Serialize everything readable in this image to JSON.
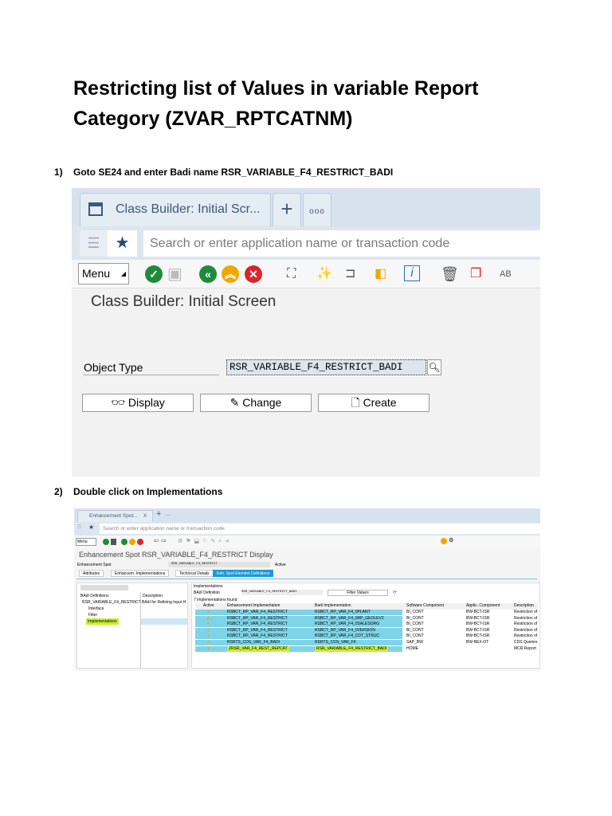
{
  "document": {
    "title_line1": "Restricting list of Values in variable Report",
    "title_line2": "Category (ZVAR_RPTCATNM)",
    "steps": [
      {
        "number": "1)",
        "text": "Goto SE24 and enter Badi name RSR_VARIABLE_F4_RESTRICT_BADI"
      },
      {
        "number": "2)",
        "text": "Double click on Implementations"
      }
    ]
  },
  "screenshot1": {
    "tab_title": "Class Builder: Initial Scr...",
    "add_tab": "+",
    "more_tabs": "ooo",
    "search_placeholder": "Search or enter application name or transaction code",
    "menu_label": "Menu",
    "screen_title": "Class Builder: Initial Screen",
    "object_type_label": "Object Type",
    "object_type_value": "RSR_VARIABLE_F4_RESTRICT_BADI",
    "buttons": {
      "display": "Display",
      "change": "Change",
      "create": "Create"
    }
  },
  "screenshot2": {
    "tab_title": "Enhancement Spot...",
    "tab_close": "X",
    "add_tab": "+",
    "more_tabs": "...",
    "search_placeholder": "Search or enter application name or transaction code",
    "menu_label": "Menu",
    "screen_title": "Enhancement Spot RSR_VARIABLE_F4_RESTRICT Display",
    "enh_spot_label": "Enhancement Spot",
    "enh_spot_value": "RSR_VARIABLE_F4_RESTRICT",
    "status": "Active",
    "tabs": [
      "Attributes",
      "Enhancem. Implementations",
      "Technical Details",
      "Enh. Spot Element Definitions"
    ],
    "tree": {
      "col_def": "BAdI Definitions",
      "col_desc": "Description",
      "root": "RSR_VARIABLE_F4_RESTRICT_BADI",
      "root_desc": "BAdI for Refining Input H",
      "children": [
        "Interface",
        "Filter",
        "Implementations"
      ]
    },
    "impl": {
      "header": "Implementations",
      "badi_def_label": "BAdI Definition",
      "badi_def_value": "RSR_VARIABLE_F4_RESTRICT_BADI",
      "filter_button": "Filter Values",
      "found": "7  implementations found",
      "columns": [
        "Active",
        "Enhancement Implementation",
        "Badi Implementation",
        "Software Component",
        "Applic. Component",
        "Description"
      ],
      "rows": [
        [
          "RSBCT_RP_VAR_F4_RESTRICT",
          "RSBCT_RP_VAR_F4_0PLANT",
          "BI_CONT",
          "BW-BCT-ISR",
          "Restriction of"
        ],
        [
          "RSBCT_RP_VAR_F4_RESTRICT",
          "RSBCT_RP_VAR_F4_0RP_GEOLEV2",
          "BI_CONT",
          "BW-BCT-ISR",
          "Restriction of"
        ],
        [
          "RSBCT_RP_VAR_F4_RESTRICT",
          "RSBCT_RP_VAR_F4_0SALESORG",
          "BI_CONT",
          "BW-BCT-ISR",
          "Restriction of"
        ],
        [
          "RSBCT_RP_VAR_F4_RESTRICT",
          "RSBCT_RP_VAR_F4_0VERSION",
          "BI_CONT",
          "BW-BCT-ISR",
          "Restriction of"
        ],
        [
          "RSBCT_RP_VAR_F4_RESTRICT",
          "RSBCT_RP_VAR_F4_CDT_STRUC",
          "BI_CONT",
          "BW-BCT-ISR",
          "Restriction of"
        ],
        [
          "RSRTS_CDS_VAR_F4_BADI",
          "RSRTS_CDS_VAR_F4",
          "SAP_BW",
          "BW-BEX-OT",
          "CDS Queries"
        ],
        [
          "ZRSR_VAR_F4_REST_REPCAT",
          "RSR_VARIABLE_F4_RESTRICT_BADI",
          "HOME",
          "",
          "MCR Report"
        ]
      ]
    },
    "highlight_yellow": "#c7f02a",
    "highlight_blue": "#7fd3e6"
  }
}
